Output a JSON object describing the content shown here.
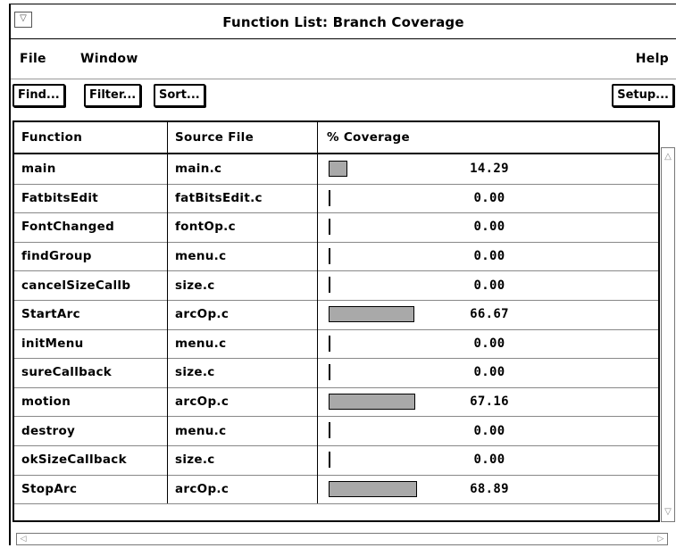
{
  "window": {
    "title": "Function List: Branch Coverage"
  },
  "menubar": {
    "file": "File",
    "window": "Window",
    "help": "Help"
  },
  "toolbar": {
    "find": "Find...",
    "filter": "Filter...",
    "sort": "Sort...",
    "setup": "Setup..."
  },
  "table": {
    "headers": {
      "function": "Function",
      "source": "Source File",
      "coverage": "% Coverage"
    },
    "rows": [
      {
        "function": "main",
        "source": "main.c",
        "coverage": "14.29",
        "coverage_fraction": 0.1429
      },
      {
        "function": "FatbitsEdit",
        "source": "fatBitsEdit.c",
        "coverage": "0.00",
        "coverage_fraction": 0
      },
      {
        "function": "FontChanged",
        "source": "fontOp.c",
        "coverage": "0.00",
        "coverage_fraction": 0
      },
      {
        "function": "findGroup",
        "source": "menu.c",
        "coverage": "0.00",
        "coverage_fraction": 0
      },
      {
        "function": "cancelSizeCallb",
        "source": "size.c",
        "coverage": "0.00",
        "coverage_fraction": 0
      },
      {
        "function": "StartArc",
        "source": "arcOp.c",
        "coverage": "66.67",
        "coverage_fraction": 0.6667
      },
      {
        "function": "initMenu",
        "source": "menu.c",
        "coverage": "0.00",
        "coverage_fraction": 0
      },
      {
        "function": "sureCallback",
        "source": "size.c",
        "coverage": "0.00",
        "coverage_fraction": 0
      },
      {
        "function": "motion",
        "source": "arcOp.c",
        "coverage": "67.16",
        "coverage_fraction": 0.6716
      },
      {
        "function": "destroy",
        "source": "menu.c",
        "coverage": "0.00",
        "coverage_fraction": 0
      },
      {
        "function": "okSizeCallback",
        "source": "size.c",
        "coverage": "0.00",
        "coverage_fraction": 0
      },
      {
        "function": "StopArc",
        "source": "arcOp.c",
        "coverage": "68.89",
        "coverage_fraction": 0.6889
      }
    ]
  },
  "colors": {
    "bar_fill": "#a9a9a9",
    "border": "#000000"
  }
}
